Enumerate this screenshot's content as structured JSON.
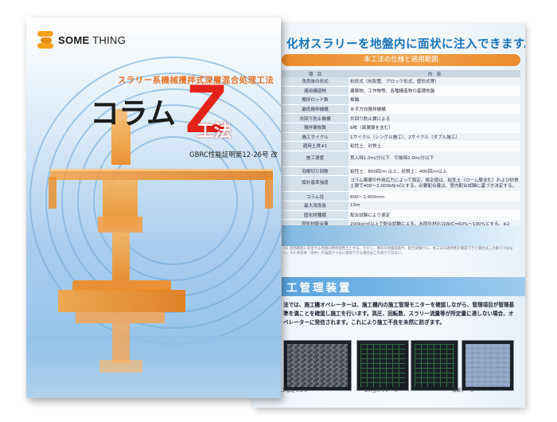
{
  "brand": {
    "name_bold": "SOME",
    "name_rest": " THING",
    "logo_icon": "s-stripes-icon",
    "logo_color": "#f3a21c"
  },
  "cover": {
    "subtitle": "スラリー系機械攪拌式深層混合処理工法",
    "title_kana": "コラム",
    "title_z": "Z",
    "title_kouhou": "工法",
    "certificate": "GBRC性能証明第12-26号 改",
    "accent_red": "#e2231a",
    "accent_orange": "#e8742a"
  },
  "back_page": {
    "headline": "化材スラリーを地盤内に面状に注入できます。",
    "spec_heading": "本工法の仕様と適用範囲",
    "table_headers": [
      "項　目",
      "内　容"
    ],
    "rows": [
      {
        "k": "改良体の形式",
        "v": "杭形式（杭配置、ブロック形式、壁形式等）"
      },
      {
        "k": "適用構造物",
        "v": "建築物、工作物等、各種構造物の基礎地盤"
      },
      {
        "k": "攪拌ロッド数",
        "v": "単軸"
      },
      {
        "k": "最低攪拌機構",
        "v": "水平方向攪拌機構"
      },
      {
        "k": "共回り防止機構",
        "v": "共回り防止翼による"
      },
      {
        "k": "攪拌翼枚数",
        "v": "6枚（面翼翼を含む）"
      },
      {
        "k": "施工サイクル",
        "v": "1サイクル（シングル施工）、2サイクル（ダブル施工）"
      },
      {
        "k": "適用土質※1",
        "v": "粘性土、砂質土"
      },
      {
        "k": "施工速度",
        "v": "貫入時1.0m/分以下　引抜時2.0m/分以下",
        "tall": true
      },
      {
        "k": "羽根切り回数",
        "v": "粘性土：600回/m 以上、砂質土：400回/m以上"
      },
      {
        "k": "設計基準強度",
        "v": "コラム築硬の作用応力によって設定。設定値は、粘性土（ローム層含む）および砂質土層で400〜2,000kN/㎡とする。必要配合量は、室内配合試験に基づき決定する。",
        "tall": true
      },
      {
        "k": "コラム径",
        "v": "800〜1,400mm"
      },
      {
        "k": "最大改良長",
        "v": "13m"
      },
      {
        "k": "固化材種類",
        "v": "配合試験により選定"
      },
      {
        "k": "固化材配合量",
        "v": "200kg/㎡以上で配合試験による。水固化材比はW/C=60%〜100%とする。※2"
      }
    ],
    "notes": "※1 適用範囲に該当する地盤は原則粘性土とする。ただし、事前の地盤調査や、配合試験から、本工法の適用性を確認できた場合はこの限りではない。※2 改良体（地中）の強度が十分に確保できる場合はこの限りではない。",
    "mgmt_title": "工管理装置",
    "mgmt_text": "法では、施工機オペレーターは、施工機内の施工管理モニターを確認しながら、管理項目が管理基準を満ことを確認し施工を行います。高圧、回転数、スラリー流量等が所定量に達しない場合、オペレーターに発信されます。これにより施工不良を未然に防ぎます。",
    "captions": [
      "施工管理モニター",
      "1m当たりデータ",
      "積算データ"
    ]
  }
}
